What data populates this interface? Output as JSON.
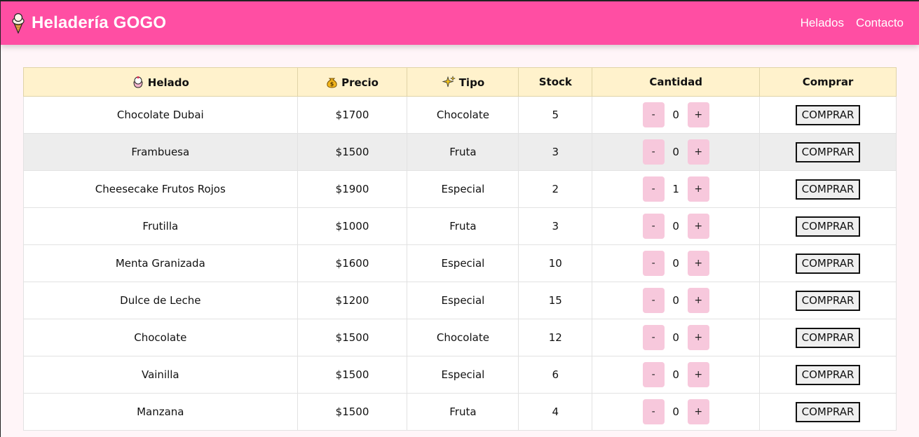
{
  "header": {
    "brand_icon": "ice-cream-cone-icon",
    "title": "Heladería GOGO",
    "nav": [
      {
        "label": "Helados"
      },
      {
        "label": "Contacto"
      }
    ]
  },
  "colors": {
    "header_bg": "#ff4ea3",
    "table_head_bg": "#fff2cc",
    "qty_button_bg": "#f7c8dc",
    "row_highlight_bg": "#ededed"
  },
  "table": {
    "columns": [
      {
        "label": "Helado",
        "icon": "ice-cream-scoop-icon"
      },
      {
        "label": "Precio",
        "icon": "money-bag-icon"
      },
      {
        "label": "Tipo",
        "icon": "sparkles-icon"
      },
      {
        "label": "Stock"
      },
      {
        "label": "Cantidad"
      },
      {
        "label": "Comprar"
      }
    ],
    "minus_label": "-",
    "plus_label": "+",
    "buy_label": "COMPRAR",
    "rows": [
      {
        "name": "Chocolate Dubai",
        "price": "$1700",
        "type": "Chocolate",
        "stock": "5",
        "qty": "0"
      },
      {
        "name": "Frambuesa",
        "price": "$1500",
        "type": "Fruta",
        "stock": "3",
        "qty": "0"
      },
      {
        "name": "Cheesecake Frutos Rojos",
        "price": "$1900",
        "type": "Especial",
        "stock": "2",
        "qty": "1"
      },
      {
        "name": "Frutilla",
        "price": "$1000",
        "type": "Fruta",
        "stock": "3",
        "qty": "0"
      },
      {
        "name": "Menta Granizada",
        "price": "$1600",
        "type": "Especial",
        "stock": "10",
        "qty": "0"
      },
      {
        "name": "Dulce de Leche",
        "price": "$1200",
        "type": "Especial",
        "stock": "15",
        "qty": "0"
      },
      {
        "name": "Chocolate",
        "price": "$1500",
        "type": "Chocolate",
        "stock": "12",
        "qty": "0"
      },
      {
        "name": "Vainilla",
        "price": "$1500",
        "type": "Especial",
        "stock": "6",
        "qty": "0"
      },
      {
        "name": "Manzana",
        "price": "$1500",
        "type": "Fruta",
        "stock": "4",
        "qty": "0"
      }
    ]
  }
}
